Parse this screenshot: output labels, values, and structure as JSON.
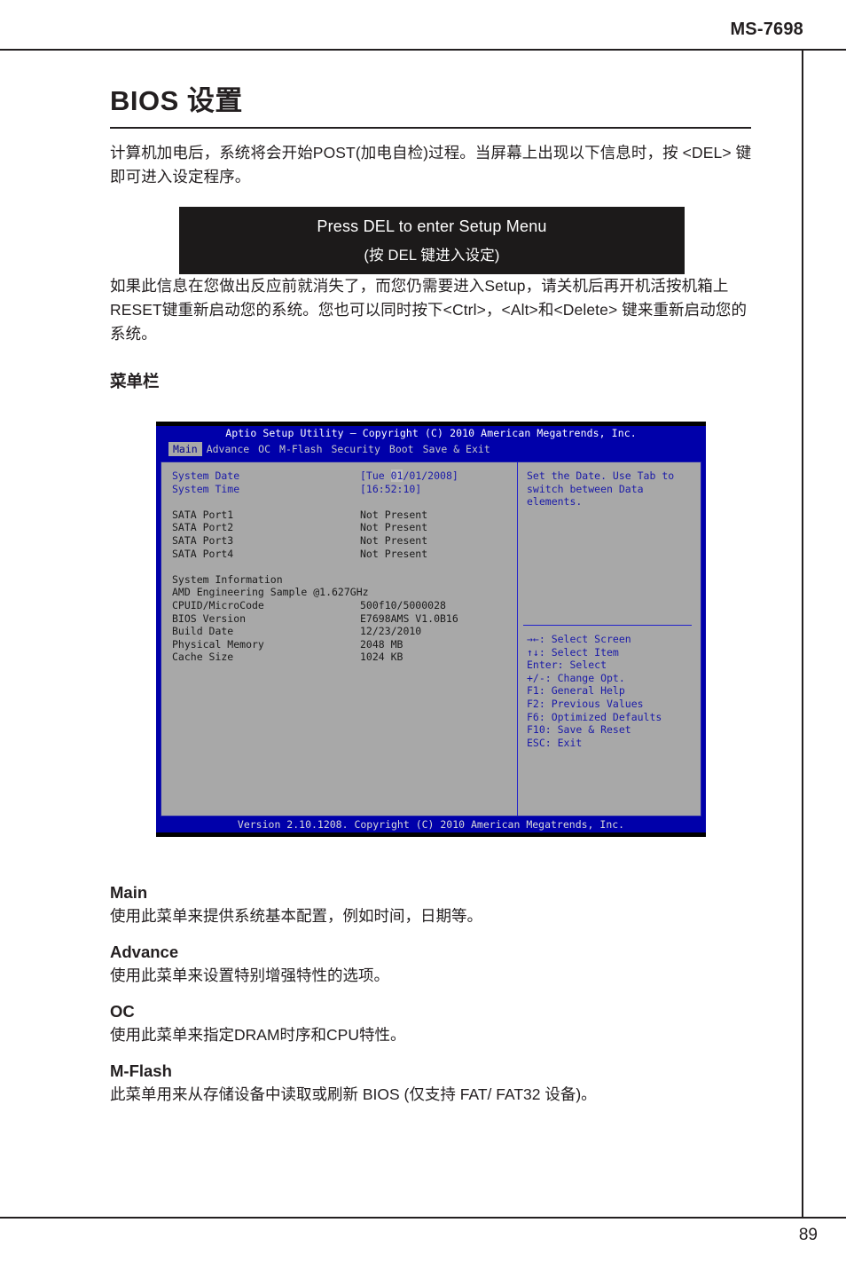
{
  "header": {
    "model": "MS-7698"
  },
  "footer": {
    "page_number": "89"
  },
  "doc": {
    "title": "BIOS 设置",
    "intro": "计算机加电后，系统将会开始POST(加电自检)过程。当屏幕上出现以下信息时，按 <DEL> 键即可进入设定程序。",
    "post_box": {
      "line1": "Press DEL to enter Setup Menu",
      "line2": "(按 DEL 键进入设定)"
    },
    "after_box": "如果此信息在您做出反应前就消失了，而您仍需要进入Setup，请关机后再开机活按机箱上RESET键重新启动您的系统。您也可以同时按下<Ctrl>，<Alt>和<Delete> 键来重新启动您的系统。",
    "menubar_heading": "菜单栏"
  },
  "bios": {
    "title": "Aptio Setup Utility – Copyright (C) 2010 American Megatrends, Inc.",
    "tabs": [
      {
        "label": "Main",
        "active": true
      },
      {
        "label": "Advance",
        "active": false
      },
      {
        "label": "OC",
        "active": false
      },
      {
        "label": "M-Flash",
        "active": false
      },
      {
        "label": "Security",
        "active": false
      },
      {
        "label": "Boot",
        "active": false
      },
      {
        "label": "Save & Exit",
        "active": false
      }
    ],
    "rows": {
      "system_date_label": "System Date",
      "system_date_prefix": "[Tue ",
      "system_date_highlight": "01",
      "system_date_suffix": "/01/2008]",
      "system_time_label": "System Time",
      "system_time_value": "[16:52:10]",
      "sata1_label": "SATA Port1",
      "sata1_value": "Not Present",
      "sata2_label": "SATA Port2",
      "sata2_value": "Not Present",
      "sata3_label": "SATA Port3",
      "sata3_value": "Not Present",
      "sata4_label": "SATA Port4",
      "sata4_value": "Not Present",
      "sysinfo_heading": "System Information",
      "cpu_name": "AMD Engineering Sample @1.627GHz",
      "cpuid_label": "CPUID/MicroCode",
      "cpuid_value": "500f10/5000028",
      "bios_version_label": "BIOS Version",
      "bios_version_value": "E7698AMS V1.0B16",
      "build_date_label": "Build Date",
      "build_date_value": "12/23/2010",
      "physical_memory_label": "Physical Memory",
      "physical_memory_value": "2048 MB",
      "cache_size_label": "Cache Size",
      "cache_size_value": "1024 KB"
    },
    "help": {
      "line1": "Set the Date. Use Tab to",
      "line2": "switch between Data elements.",
      "keys": [
        "→←: Select Screen",
        "↑↓: Select Item",
        "Enter: Select",
        "+/-: Change Opt.",
        "F1: General Help",
        "F2: Previous Values",
        "F6: Optimized Defaults",
        "F10: Save & Reset",
        "ESC: Exit"
      ]
    },
    "version_footer": "Version 2.10.1208. Copyright (C) 2010 American Megatrends, Inc."
  },
  "descriptions": [
    {
      "term": "Main",
      "text": "使用此菜单来提供系统基本配置，例如时间，日期等。"
    },
    {
      "term": "Advance",
      "text": "使用此菜单来设置特别增强特性的选项。"
    },
    {
      "term": "OC",
      "text": "使用此菜单来指定DRAM时序和CPU特性。"
    },
    {
      "term": "M-Flash",
      "text": "此菜单用来从存储设备中读取或刷新 BIOS (仅支持 FAT/ FAT32 设备)。"
    }
  ],
  "colors": {
    "bios_blue": "#0000aa",
    "bios_gray": "#a8a8a8",
    "bios_text_blue": "#1a1aa8",
    "ink": "#231f20"
  }
}
